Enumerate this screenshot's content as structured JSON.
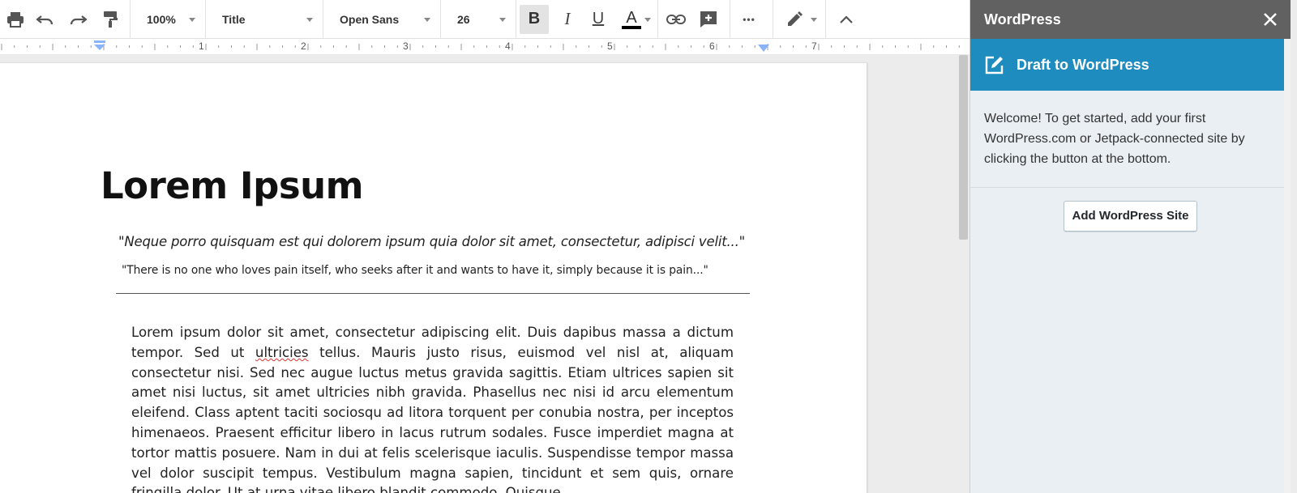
{
  "toolbar": {
    "zoom": "100%",
    "style": "Title",
    "font": "Open Sans",
    "size": "26",
    "bold": "B",
    "italic": "I",
    "underline": "U",
    "text_color_letter": "A",
    "more": "•••"
  },
  "ruler": {
    "numbers": [
      "1",
      "2",
      "3",
      "4",
      "5",
      "6",
      "7"
    ]
  },
  "document": {
    "title": "Lorem Ipsum",
    "quote": "\"Neque porro quisquam est qui dolorem ipsum quia dolor sit amet, consectetur, adipisci velit...\"",
    "translation": "\"There is no one who loves pain itself, who seeks after it and wants to have it, simply because it is pain...\"",
    "body_before": "Lorem ipsum dolor sit amet, consectetur adipiscing elit. Duis dapibus massa a dictum tempor. Sed ut ",
    "body_misspelled": "ultricies",
    "body_after": " tellus. Mauris justo risus, euismod vel nisl at, aliquam consectetur nisi. Sed nec augue luctus metus gravida sagittis. Etiam ultrices sapien sit amet nisi luctus, sit amet ultricies nibh gravida. Phasellus nec nisi id arcu elementum eleifend. Class aptent taciti sociosqu ad litora torquent per conubia nostra, per inceptos himenaeos. Praesent efficitur libero in lacus rutrum sodales. Fusce imperdiet magna at tortor mattis posuere. Nam in dui at felis scelerisque iaculis. Suspendisse tempor massa vel dolor suscipit tempus. Vestibulum magna sapien, tincidunt et sem quis, ornare fringilla dolor. Ut at urna vitae libero blandit commodo. Quisque"
  },
  "sidebar": {
    "title": "WordPress",
    "banner": "Draft to WordPress",
    "welcome": "Welcome! To get started, add your first WordPress.com or Jetpack-connected site by clicking the button at the bottom.",
    "add_button": "Add WordPress Site"
  },
  "colors": {
    "sidebar_header": "#616161",
    "banner": "#1e8cbe",
    "sidebar_bg": "#e9eff3",
    "ruler_marker": "#8ab4f8"
  }
}
